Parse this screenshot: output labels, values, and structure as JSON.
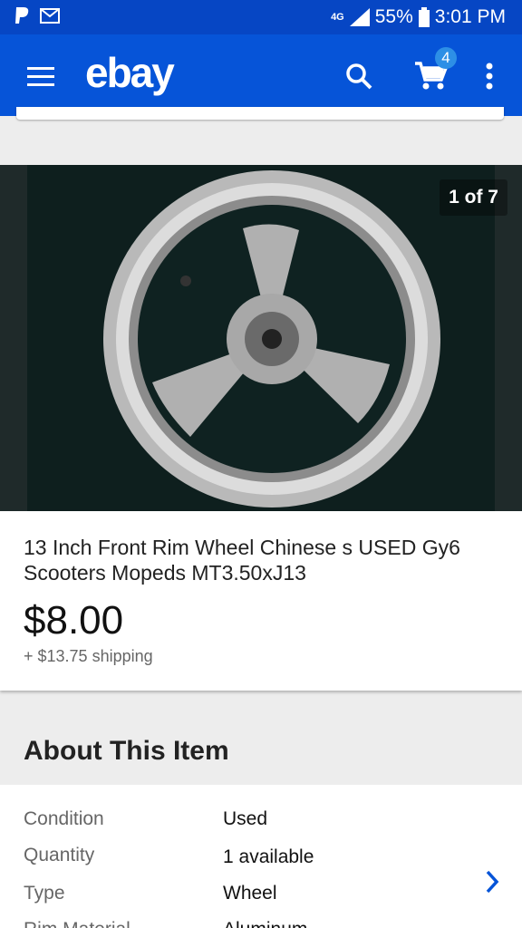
{
  "status": {
    "network": "4G",
    "battery": "55%",
    "time": "3:01 PM"
  },
  "app_bar": {
    "logo": "ebay",
    "cart_count": "4"
  },
  "gallery": {
    "counter": "1 of 7"
  },
  "listing": {
    "title": "13 Inch Front Rim Wheel Chinese s USED Gy6 Scooters Mopeds MT3.50xJ13",
    "price": "$8.00",
    "shipping": "+ $13.75 shipping"
  },
  "about": {
    "header": "About This Item",
    "rows": [
      {
        "label": "Condition",
        "value": "Used"
      },
      {
        "label": "Quantity",
        "value": "1 available"
      },
      {
        "label": "Type",
        "value": "Wheel"
      },
      {
        "label": "Rim Material",
        "value": "Aluminum"
      }
    ]
  },
  "colors": {
    "app_bar": "#0654d8",
    "status_bar": "#0646c4",
    "accent": "#0654d8"
  }
}
